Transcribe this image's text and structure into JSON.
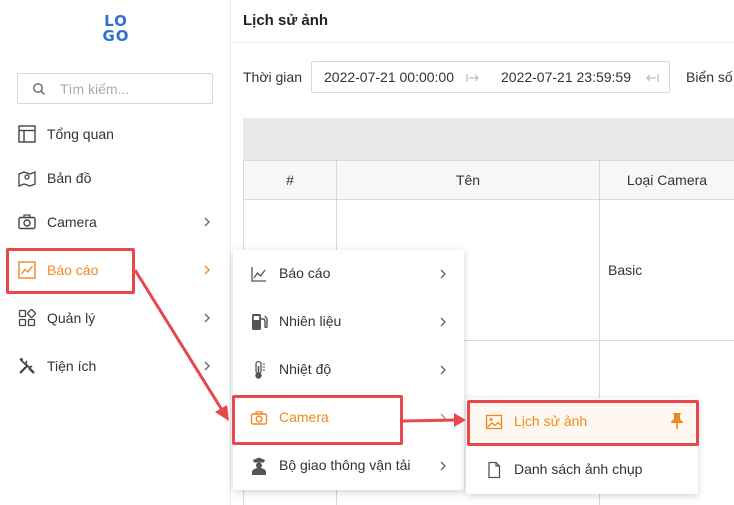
{
  "logo": {
    "line1": "LO",
    "line2": "GO"
  },
  "search": {
    "placeholder": "Tìm kiếm..."
  },
  "sidebar": {
    "items": [
      {
        "label": "Tổng quan",
        "icon": "layout-icon",
        "has_submenu": false
      },
      {
        "label": "Bản đồ",
        "icon": "map-icon",
        "has_submenu": false
      },
      {
        "label": "Camera",
        "icon": "camera-icon",
        "has_submenu": true
      },
      {
        "label": "Báo cáo",
        "icon": "chart-icon",
        "has_submenu": true,
        "active": true
      },
      {
        "label": "Quản lý",
        "icon": "apps-icon",
        "has_submenu": true
      },
      {
        "label": "Tiện ích",
        "icon": "tools-icon",
        "has_submenu": true
      }
    ]
  },
  "header": {
    "title": "Lịch sử ảnh"
  },
  "filters": {
    "time_label": "Thời gian",
    "start": "2022-07-21 00:00:00",
    "end": "2022-07-21 23:59:59",
    "plate_label": "Biển số"
  },
  "table": {
    "columns": [
      "#",
      "Tên",
      "Loại Camera"
    ],
    "rows": [
      {
        "camera_type": "Basic"
      }
    ]
  },
  "report_submenu": {
    "items": [
      {
        "label": "Báo cáo",
        "icon": "chart-line-icon"
      },
      {
        "label": "Nhiên liệu",
        "icon": "fuel-pump-icon"
      },
      {
        "label": "Nhiệt độ",
        "icon": "thermometer-icon"
      },
      {
        "label": "Camera",
        "icon": "camera-icon",
        "active": true
      },
      {
        "label": "Bộ giao thông vận tải",
        "icon": "officer-icon"
      }
    ]
  },
  "camera_submenu": {
    "items": [
      {
        "label": "Lịch sử ảnh",
        "icon": "image-icon",
        "active": true,
        "pinned": true
      },
      {
        "label": "Danh sách ảnh chụp",
        "icon": "file-icon"
      }
    ]
  },
  "colors": {
    "accent": "#f0891d",
    "highlight": "#e8474b",
    "logo": "#2e6fd6"
  }
}
